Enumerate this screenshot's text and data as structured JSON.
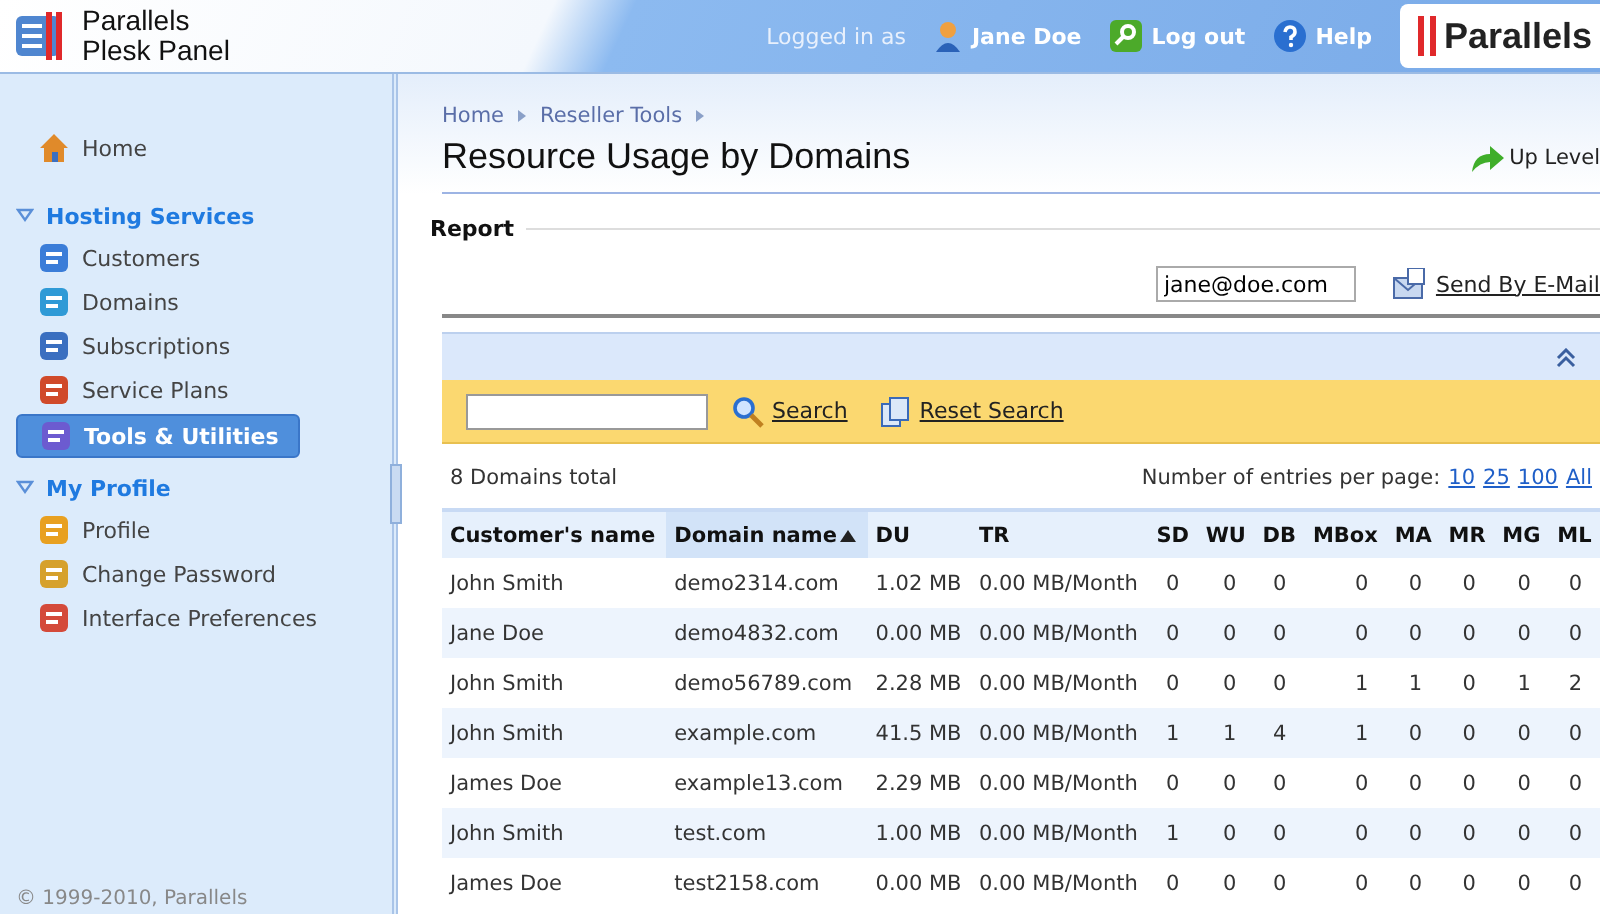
{
  "header": {
    "product_line1": "Parallels",
    "product_line2": "Plesk Panel",
    "logged_in_label": "Logged in as",
    "user": "Jane Doe",
    "logout": "Log out",
    "help": "Help",
    "brand": "Parallels"
  },
  "sidebar": {
    "home": {
      "label": "Home",
      "selected": false
    },
    "sections": [
      {
        "title": "Hosting Services",
        "expanded": true,
        "items": [
          {
            "label": "Customers",
            "selected": false
          },
          {
            "label": "Domains",
            "selected": false
          },
          {
            "label": "Subscriptions",
            "selected": false
          },
          {
            "label": "Service Plans",
            "selected": false
          },
          {
            "label": "Tools & Utilities",
            "selected": true
          }
        ]
      },
      {
        "title": "My Profile",
        "expanded": true,
        "items": [
          {
            "label": "Profile",
            "selected": false
          },
          {
            "label": "Change Password",
            "selected": false
          },
          {
            "label": "Interface Preferences",
            "selected": false
          }
        ]
      }
    ],
    "copyright": "© 1999-2010, Parallels"
  },
  "breadcrumbs": [
    "Home",
    "Reseller Tools"
  ],
  "page_title": "Resource Usage by Domains",
  "up_level": "Up Level",
  "report": {
    "title": "Report",
    "email": "jane@doe.com",
    "send_button": "Send By E-Mail"
  },
  "search": {
    "search_button": "Search",
    "reset_button": "Reset Search"
  },
  "total": "8 Domains total",
  "per_page": {
    "label": "Number of entries per page:",
    "options": [
      "10",
      "25",
      "100",
      "All"
    ]
  },
  "table": {
    "columns": [
      {
        "label": "Customer's name",
        "sorted": false
      },
      {
        "label": "Domain name",
        "sorted": true
      },
      {
        "label": "DU",
        "sorted": false
      },
      {
        "label": "TR",
        "sorted": false
      },
      {
        "label": "SD",
        "sorted": false
      },
      {
        "label": "WU",
        "sorted": false
      },
      {
        "label": "DB",
        "sorted": false
      },
      {
        "label": "MBox",
        "sorted": false
      },
      {
        "label": "MA",
        "sorted": false
      },
      {
        "label": "MR",
        "sorted": false
      },
      {
        "label": "MG",
        "sorted": false
      },
      {
        "label": "ML",
        "sorted": false
      }
    ],
    "rows": [
      [
        "John Smith",
        "demo2314.com",
        "1.02 MB",
        "0.00 MB/Month",
        "0",
        "0",
        "0",
        "0",
        "0",
        "0",
        "0",
        "0"
      ],
      [
        "Jane Doe",
        "demo4832.com",
        "0.00 MB",
        "0.00 MB/Month",
        "0",
        "0",
        "0",
        "0",
        "0",
        "0",
        "0",
        "0"
      ],
      [
        "John Smith",
        "demo56789.com",
        "2.28 MB",
        "0.00 MB/Month",
        "0",
        "0",
        "0",
        "1",
        "1",
        "0",
        "1",
        "2"
      ],
      [
        "John Smith",
        "example.com",
        "41.5 MB",
        "0.00 MB/Month",
        "1",
        "1",
        "4",
        "1",
        "0",
        "0",
        "0",
        "0"
      ],
      [
        "James Doe",
        "example13.com",
        "2.29 MB",
        "0.00 MB/Month",
        "0",
        "0",
        "0",
        "0",
        "0",
        "0",
        "0",
        "0"
      ],
      [
        "John Smith",
        "test.com",
        "1.00 MB",
        "0.00 MB/Month",
        "1",
        "0",
        "0",
        "0",
        "0",
        "0",
        "0",
        "0"
      ],
      [
        "James Doe",
        "test2158.com",
        "0.00 MB",
        "0.00 MB/Month",
        "0",
        "0",
        "0",
        "0",
        "0",
        "0",
        "0",
        "0"
      ]
    ]
  }
}
